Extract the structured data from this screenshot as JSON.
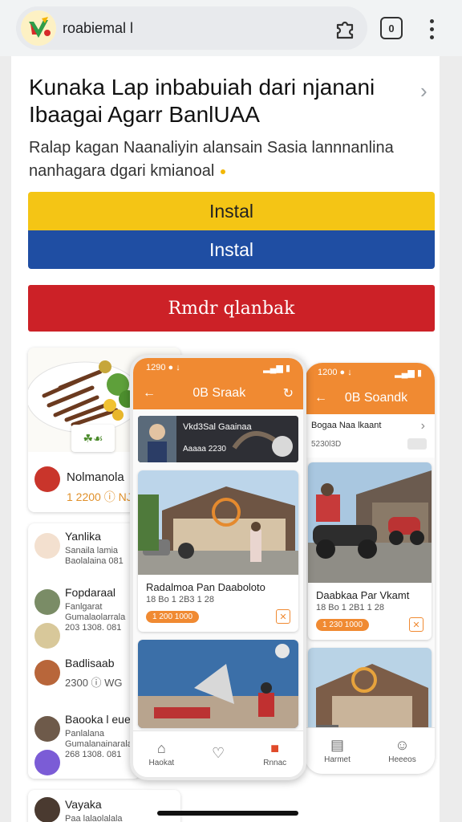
{
  "browser": {
    "url_text": "roabiemal l",
    "extension_icon": "puzzle-icon",
    "tabs_count": "0",
    "menu_icon": "more-vert-icon"
  },
  "listing": {
    "headline": "Kunaka Lap inbabuiah dari njanani Ibaagai Agarr BanlUAA",
    "description": "Ralap kagan Naanaliyin alansain Sasia lannnanlina nanhagara dgari kmianoal",
    "install_yellow": "Instal",
    "install_blue": "Instal",
    "red_button": "Rmdr qlanbak"
  },
  "left_feed": {
    "food": {
      "name": "Nolmanola",
      "price": "1 2200 ⓘ NJS"
    },
    "items": [
      {
        "title": "Yanlika",
        "sub1": "Sanaila lamia",
        "sub2": "Baolalaina 081"
      },
      {
        "title": "Fopdaraal",
        "sub1": "Fanlgarat",
        "sub2": "Gumalaolarrala",
        "sub3": "203 1308. 081"
      },
      {
        "title": "Badlisaab",
        "sub1": "2300 ⓘ WG",
        "sub2": ""
      },
      {
        "title": "Baooka l eue",
        "sub1": "Panlalana",
        "sub2": "Gumalanainarala",
        "sub3": "268 1308. 081"
      },
      {
        "title": "Vayaka",
        "sub1": "Paa lalaolalala",
        "sub2": ""
      }
    ]
  },
  "phone_front": {
    "status_time": "1290 ● ↓",
    "status_right": "▂▄▆ ▮",
    "header_title": "0B Sraak",
    "banner_text": "Vkd3Sal Gaainaa",
    "banner_sub": "Aaaaa 2230",
    "post1": {
      "title": "Radalmoa Pan Daaboloto",
      "sub": "18 Bo 1 2B3 1 28",
      "pill": "1 200 1000"
    },
    "post2": {
      "title": "",
      "sub": "",
      "pill": ""
    },
    "nav": [
      {
        "icon": "home-icon",
        "label": "Haokat"
      },
      {
        "icon": "heart-icon",
        "label": ""
      },
      {
        "icon": "bag-icon",
        "label": "Rnnac"
      }
    ]
  },
  "phone_back": {
    "status_time": "1200 ● ↓",
    "status_right": "▂▄▆ ▮",
    "header_title": "0B Soandk",
    "top_row_title": "Bogaa Naa lkaant",
    "top_row_sub": "5230l3D",
    "post1": {
      "title": "Daabkaa Par Vkamt",
      "sub": "18 Bo 1 2B1 1 28",
      "pill": "1 230 1000"
    },
    "nav": [
      {
        "icon": "book-icon",
        "label": "Harmet"
      },
      {
        "icon": "person-icon",
        "label": "Heeeos"
      }
    ]
  },
  "colors": {
    "install_yellow": "#f4c515",
    "install_blue": "#1f4ea3",
    "red_button": "#cc2127",
    "app_orange": "#f08a32"
  }
}
